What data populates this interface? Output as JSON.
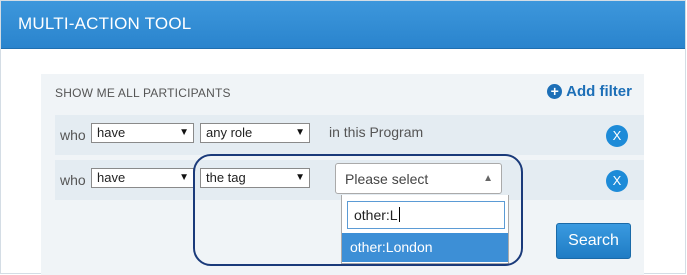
{
  "panel": {
    "title": "MULTI-ACTION TOOL"
  },
  "filter_box": {
    "label": "SHOW ME ALL PARTICIPANTS",
    "add_filter_label": "Add filter",
    "add_filter_icon": "plus-circle-icon"
  },
  "rows": [
    {
      "who_label": "who",
      "have_value": "have",
      "condition_value": "any role",
      "suffix": "in this Program",
      "remove_label": "X"
    },
    {
      "who_label": "who",
      "have_value": "have",
      "condition_value": "the tag",
      "remove_label": "X"
    }
  ],
  "tag_select": {
    "placeholder": "Please select",
    "search_value": "other:L",
    "options": [
      "other:London"
    ]
  },
  "search_button": {
    "label": "Search"
  },
  "colors": {
    "header": "#2a84cd",
    "accent": "#1d6fb7",
    "highlight_option": "#3d8fd6",
    "annotation_oval": "#1a3a7a"
  }
}
